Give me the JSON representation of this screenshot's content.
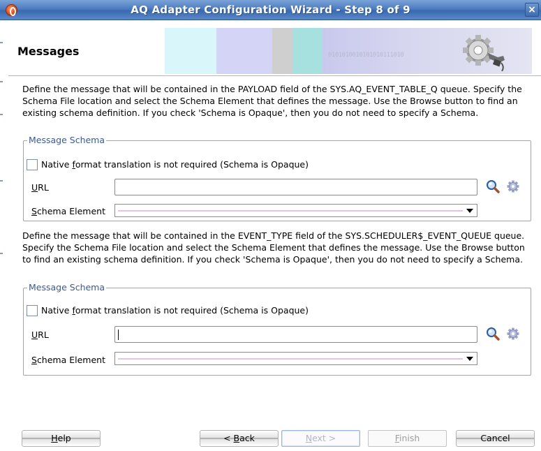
{
  "window": {
    "title": "AQ Adapter Configuration Wizard - Step 8 of 9",
    "close_glyph": "×"
  },
  "header": {
    "title": "Messages",
    "binary_text": "0101010010101010111010"
  },
  "section1": {
    "description": "Define the message that will be contained in the PAYLOAD field of the SYS.AQ_EVENT_TABLE_Q queue. Specify the Schema File location and select the Schema Element that defines the message. Use the Browse button to find an existing schema definition. If you check 'Schema is Opaque', then you do not need to specify a Schema.",
    "group_title": "Message Schema",
    "opaque_checkbox": {
      "label_pre": "Native ",
      "label_mnemonic": "f",
      "label_post": "ormat translation is not required (Schema is Opaque)",
      "checked": false
    },
    "url": {
      "label_mnemonic": "U",
      "label_rest": "RL",
      "value": ""
    },
    "schema_element": {
      "label_mnemonic": "S",
      "label_rest": "chema Element",
      "value": ""
    }
  },
  "section2": {
    "description": "Define the message that will be contained in the EVENT_TYPE field of the SYS.SCHEDULER$_EVENT_QUEUE queue.  Specify the Schema File location and select the Schema Element that defines the message. Use the Browse button to find an existing schema definition. If you check 'Schema is Opaque', then you do not need to specify a Schema.",
    "group_title": "Message Schema",
    "opaque_checkbox": {
      "label_pre": "Native ",
      "label_mnemonic": "f",
      "label_post": "ormat translation is not required (Schema is Opaque)",
      "checked": false
    },
    "url": {
      "label_mnemonic": "U",
      "label_rest": "RL",
      "value": ""
    },
    "schema_element": {
      "label_mnemonic": "S",
      "label_rest": "chema Element",
      "value": ""
    }
  },
  "buttons": {
    "help": {
      "mnemonic": "H",
      "rest": "elp"
    },
    "back": {
      "pre": "< ",
      "mnemonic": "B",
      "rest": "ack"
    },
    "next": {
      "mnemonic": "N",
      "rest": "ext >"
    },
    "finish": {
      "mnemonic": "F",
      "rest": "inish"
    },
    "cancel": {
      "label": "Cancel"
    }
  },
  "colors": {
    "titlebar": "#4d7cc0",
    "group_legend": "#3b5b8f",
    "disabled_text": "#9c9c9c"
  },
  "icons": [
    "app-icon",
    "close-icon",
    "search-icon",
    "gear-icon",
    "dropdown-arrow-icon"
  ]
}
